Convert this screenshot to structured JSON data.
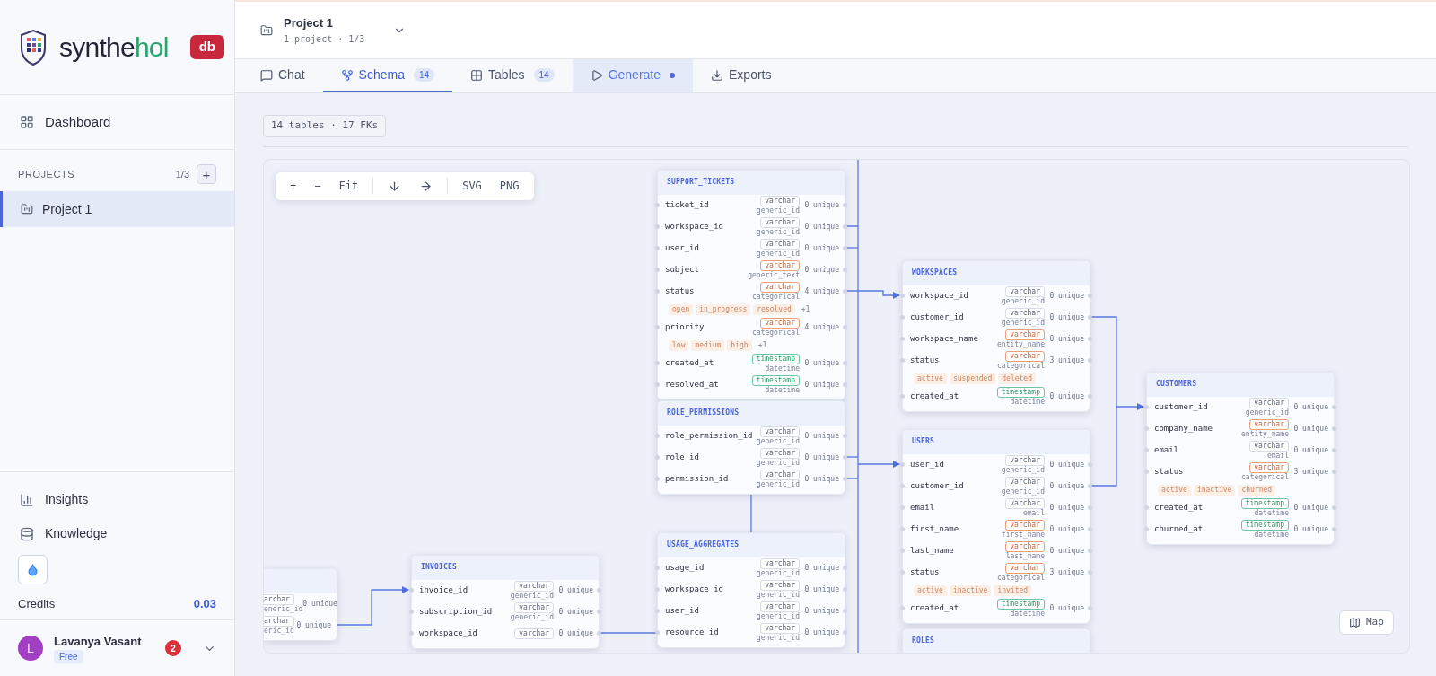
{
  "brand": {
    "name_start": "synthe",
    "name_end": "hol",
    "badge": "db"
  },
  "sidebar": {
    "top_items": [
      {
        "label": "Dashboard",
        "selected": false
      }
    ],
    "projects": {
      "heading": "PROJECTS",
      "count": "1/3",
      "add": "+",
      "items": [
        {
          "label": "Project 1",
          "selected": true
        }
      ]
    },
    "bottom_items": [
      {
        "label": "Insights",
        "kind": "chart"
      },
      {
        "label": "Knowledge",
        "kind": "database"
      }
    ],
    "credits": {
      "label": "Credits",
      "value": "0.03"
    },
    "user": {
      "initial": "L",
      "name": "Lavanya Vasant",
      "plan": "Free",
      "notifications": "2"
    }
  },
  "project": {
    "title": "Project 1",
    "subtitle": "1 project · 1/3"
  },
  "tabs": [
    {
      "label": "Chat",
      "kind": "chat",
      "selected": false,
      "highlighted": false
    },
    {
      "label": "Schema",
      "kind": "schema",
      "count": "14",
      "selected": true,
      "highlighted": false
    },
    {
      "label": "Tables",
      "kind": "tables",
      "count": "14",
      "selected": false,
      "highlighted": false
    },
    {
      "label": "Generate",
      "kind": "generate",
      "selected": false,
      "highlighted": true,
      "pending": true
    },
    {
      "label": "Exports",
      "kind": "exports",
      "selected": false,
      "highlighted": false
    }
  ],
  "summary": "14 tables · 17 FKs",
  "toolbar": [
    {
      "label": "+",
      "kind": "text"
    },
    {
      "label": "−",
      "kind": "text"
    },
    {
      "label": "Fit",
      "kind": "text"
    },
    {
      "kind": "down"
    },
    {
      "kind": "right"
    },
    {
      "label": "SVG",
      "kind": "text"
    },
    {
      "label": "PNG",
      "kind": "text"
    }
  ],
  "map_button": "Map",
  "tables": [
    {
      "name": "SUPPORT_TICKETS",
      "columns": [
        {
          "name": "ticket_id",
          "type": "varchar",
          "kind": "plain",
          "semantic": "generic_id",
          "unique": "0 unique"
        },
        {
          "name": "workspace_id",
          "type": "varchar",
          "kind": "plain",
          "semantic": "generic_id",
          "unique": "0 unique"
        },
        {
          "name": "user_id",
          "type": "varchar",
          "kind": "plain",
          "semantic": "generic_id",
          "unique": "0 unique"
        },
        {
          "name": "subject",
          "type": "varchar",
          "kind": "semantic",
          "semantic": "generic_text",
          "unique": "0 unique"
        },
        {
          "name": "status",
          "type": "varchar",
          "kind": "semantic",
          "semantic": "categorical",
          "unique": "4 unique",
          "values": [
            "open",
            "in_progress",
            "resolved"
          ],
          "more": "+1"
        },
        {
          "name": "priority",
          "type": "varchar",
          "kind": "semantic",
          "semantic": "categorical",
          "unique": "4 unique",
          "values": [
            "low",
            "medium",
            "high"
          ],
          "more": "+1"
        },
        {
          "name": "created_at",
          "type": "timestamp",
          "kind": "time",
          "semantic": "datetime",
          "unique": "0 unique"
        },
        {
          "name": "resolved_at",
          "type": "timestamp",
          "kind": "time",
          "semantic": "datetime",
          "unique": "0 unique"
        }
      ]
    },
    {
      "name": "ROLE_PERMISSIONS",
      "columns": [
        {
          "name": "role_permission_id",
          "type": "varchar",
          "kind": "plain",
          "semantic": "generic_id",
          "unique": "0 unique"
        },
        {
          "name": "role_id",
          "type": "varchar",
          "kind": "plain",
          "semantic": "generic_id",
          "unique": "0 unique"
        },
        {
          "name": "permission_id",
          "type": "varchar",
          "kind": "plain",
          "semantic": "generic_id",
          "unique": "0 unique"
        }
      ]
    },
    {
      "name": "USAGE_AGGREGATES",
      "columns": [
        {
          "name": "usage_id",
          "type": "varchar",
          "kind": "plain",
          "semantic": "generic_id",
          "unique": "0 unique"
        },
        {
          "name": "workspace_id",
          "type": "varchar",
          "kind": "plain",
          "semantic": "generic_id",
          "unique": "0 unique"
        },
        {
          "name": "user_id",
          "type": "varchar",
          "kind": "plain",
          "semantic": "generic_id",
          "unique": "0 unique"
        },
        {
          "name": "resource_id",
          "type": "varchar",
          "kind": "plain",
          "semantic": "generic_id",
          "unique": "0 unique"
        }
      ]
    },
    {
      "name": "WORKSPACES",
      "columns": [
        {
          "name": "workspace_id",
          "type": "varchar",
          "kind": "plain",
          "semantic": "generic_id",
          "unique": "0 unique"
        },
        {
          "name": "customer_id",
          "type": "varchar",
          "kind": "plain",
          "semantic": "generic_id",
          "unique": "0 unique"
        },
        {
          "name": "workspace_name",
          "type": "varchar",
          "kind": "semantic",
          "semantic": "entity_name",
          "unique": "0 unique"
        },
        {
          "name": "status",
          "type": "varchar",
          "kind": "semantic",
          "semantic": "categorical",
          "unique": "3 unique",
          "values": [
            "active",
            "suspended",
            "deleted"
          ]
        },
        {
          "name": "created_at",
          "type": "timestamp",
          "kind": "time",
          "semantic": "datetime",
          "unique": "0 unique"
        }
      ]
    },
    {
      "name": "USERS",
      "columns": [
        {
          "name": "user_id",
          "type": "varchar",
          "kind": "plain",
          "semantic": "generic_id",
          "unique": "0 unique"
        },
        {
          "name": "customer_id",
          "type": "varchar",
          "kind": "plain",
          "semantic": "generic_id",
          "unique": "0 unique"
        },
        {
          "name": "email",
          "type": "varchar",
          "kind": "plain",
          "semantic": "email",
          "unique": "0 unique"
        },
        {
          "name": "first_name",
          "type": "varchar",
          "kind": "semantic",
          "semantic": "first_name",
          "unique": "0 unique"
        },
        {
          "name": "last_name",
          "type": "varchar",
          "kind": "semantic",
          "semantic": "last_name",
          "unique": "0 unique"
        },
        {
          "name": "status",
          "type": "varchar",
          "kind": "semantic",
          "semantic": "categorical",
          "unique": "3 unique",
          "values": [
            "active",
            "inactive",
            "invited"
          ]
        },
        {
          "name": "created_at",
          "type": "timestamp",
          "kind": "time",
          "semantic": "datetime",
          "unique": "0 unique"
        }
      ]
    },
    {
      "name": "ROLES"
    },
    {
      "name": "CUSTOMERS",
      "columns": [
        {
          "name": "customer_id",
          "type": "varchar",
          "kind": "plain",
          "semantic": "generic_id",
          "unique": "0 unique"
        },
        {
          "name": "company_name",
          "type": "varchar",
          "kind": "semantic",
          "semantic": "entity_name",
          "unique": "0 unique"
        },
        {
          "name": "email",
          "type": "varchar",
          "kind": "plain",
          "semantic": "email",
          "unique": "0 unique"
        },
        {
          "name": "status",
          "type": "varchar",
          "kind": "semantic",
          "semantic": "categorical",
          "unique": "3 unique",
          "values": [
            "active",
            "inactive",
            "churned"
          ]
        },
        {
          "name": "created_at",
          "type": "timestamp",
          "kind": "time",
          "semantic": "datetime",
          "unique": "0 unique"
        },
        {
          "name": "churned_at",
          "type": "timestamp",
          "kind": "time",
          "semantic": "datetime",
          "unique": "0 unique"
        }
      ]
    },
    {
      "name": "INVOICES",
      "columns": [
        {
          "name": "invoice_id",
          "type": "varchar",
          "kind": "plain",
          "semantic": "generic_id",
          "unique": "0 unique"
        },
        {
          "name": "subscription_id",
          "type": "varchar",
          "kind": "plain",
          "semantic": "generic_id",
          "unique": "0 unique"
        },
        {
          "name": "workspace_id",
          "type": "varchar",
          "kind": "plain",
          "unique": "0 unique"
        }
      ]
    }
  ],
  "partial_table": {
    "columns": [
      {
        "type": "archar",
        "semantic": "eneric_id",
        "unique": "0 unique"
      },
      {
        "type": "archar",
        "semantic": "eric_id",
        "unique": "0 unique"
      }
    ]
  }
}
